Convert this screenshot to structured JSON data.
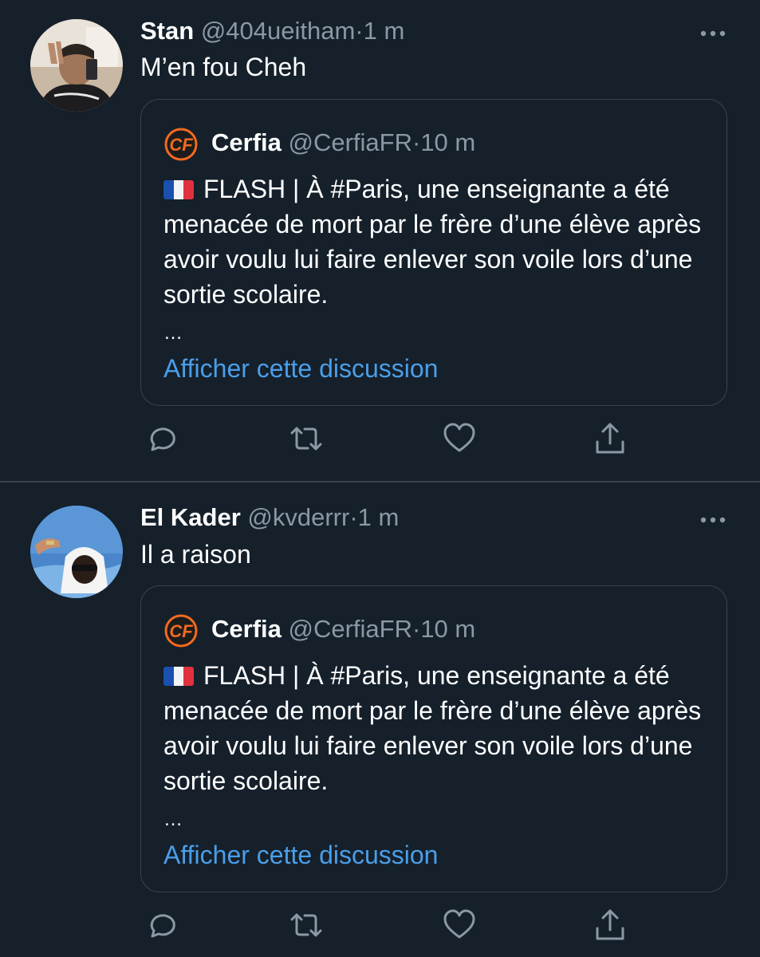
{
  "tweets": [
    {
      "author": {
        "name": "Stan",
        "handle": "@404ueitham"
      },
      "dot": "·",
      "time": "1 m",
      "text": "M’en fou Cheh",
      "quote": {
        "author": {
          "name": "Cerfia",
          "handle": "@CerfiaFR"
        },
        "dot": "·",
        "time": "10 m",
        "text": "FLASH | À #Paris, une enseignante a été menacée de mort par le frère d’une élève après avoir voulu lui faire enlever son voile lors d’une sortie scolaire.",
        "ellipsis": "…",
        "link": "Afficher cette discussion"
      }
    },
    {
      "author": {
        "name": "El Kader",
        "handle": "@kvderrr"
      },
      "dot": "·",
      "time": "1 m",
      "text": "Il a raison",
      "quote": {
        "author": {
          "name": "Cerfia",
          "handle": "@CerfiaFR"
        },
        "dot": "·",
        "time": "10 m",
        "text": "FLASH | À #Paris, une enseignante a été menacée de mort par le frère d’une élève après avoir voulu lui faire enlever son voile lors d’une sortie scolaire.",
        "ellipsis": "…",
        "link": "Afficher cette discussion"
      }
    }
  ],
  "icons": {
    "more": "more-horizontal-icon",
    "reply": "reply-icon",
    "retweet": "retweet-icon",
    "like": "heart-icon",
    "share": "share-icon",
    "flag": "france-flag-icon",
    "logo": "cerfia-logo-icon"
  },
  "colors": {
    "background": "#15202b",
    "border": "#38444d",
    "secondary_text": "#8b98a5",
    "link": "#4b9ee8"
  }
}
